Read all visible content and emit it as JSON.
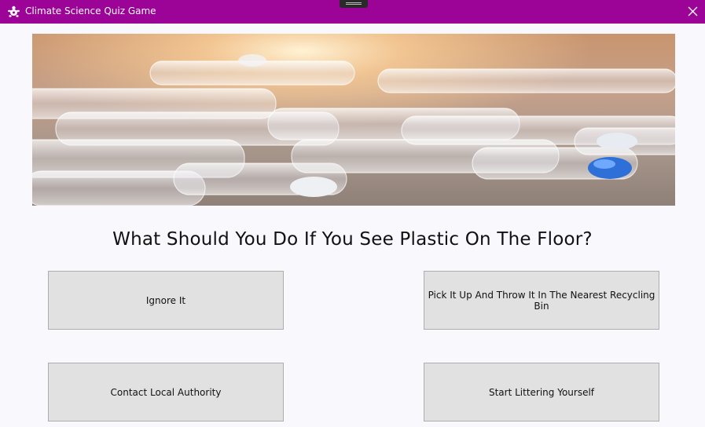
{
  "window": {
    "title": "Climate Science Quiz Game",
    "icon": "turtle-icon",
    "accent_color": "#9b0497"
  },
  "question": {
    "text": "What Should You Do If You See Plastic On The Floor?",
    "image": "plastic-bottles-photo"
  },
  "answers": [
    {
      "label": "Ignore It"
    },
    {
      "label": "Pick It Up And Throw It In The Nearest Recycling Bin"
    },
    {
      "label": "Contact Local Authority"
    },
    {
      "label": "Start Littering Yourself"
    }
  ]
}
